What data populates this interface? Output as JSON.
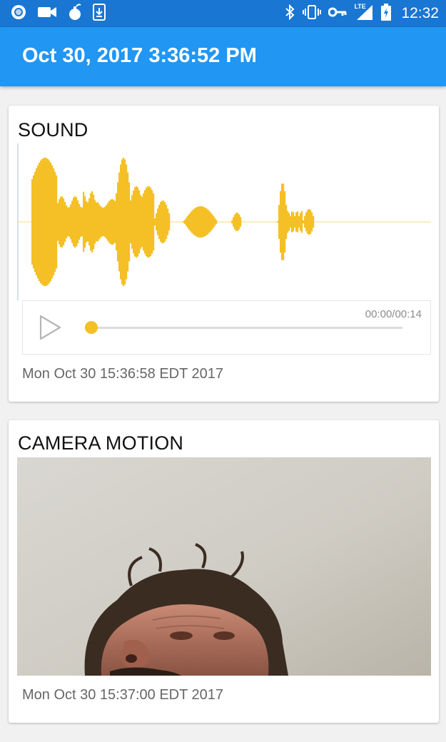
{
  "status_bar": {
    "time": "12:32",
    "network": "LTE",
    "left_icons": [
      "record-dot-icon",
      "video-camera-icon",
      "bomb-icon",
      "download-icon"
    ],
    "right_icons": [
      "bluetooth-icon",
      "vibrate-icon",
      "key-icon",
      "signal-icon",
      "battery-charging-icon"
    ]
  },
  "app_bar": {
    "title": "Oct 30, 2017 3:36:52 PM"
  },
  "sound_card": {
    "title": "SOUND",
    "player": {
      "current": "00:00",
      "duration": "00:14",
      "time_display": "00:00/00:14",
      "progress": 0
    },
    "timestamp": "Mon Oct 30 15:36:58 EDT 2017",
    "wave_color": "#f4c025"
  },
  "camera_card": {
    "title": "CAMERA MOTION",
    "timestamp": "Mon Oct 30 15:37:00 EDT 2017"
  },
  "colors": {
    "status_bar": "#1976d2",
    "app_bar": "#2196f3",
    "accent": "#f4c025"
  }
}
